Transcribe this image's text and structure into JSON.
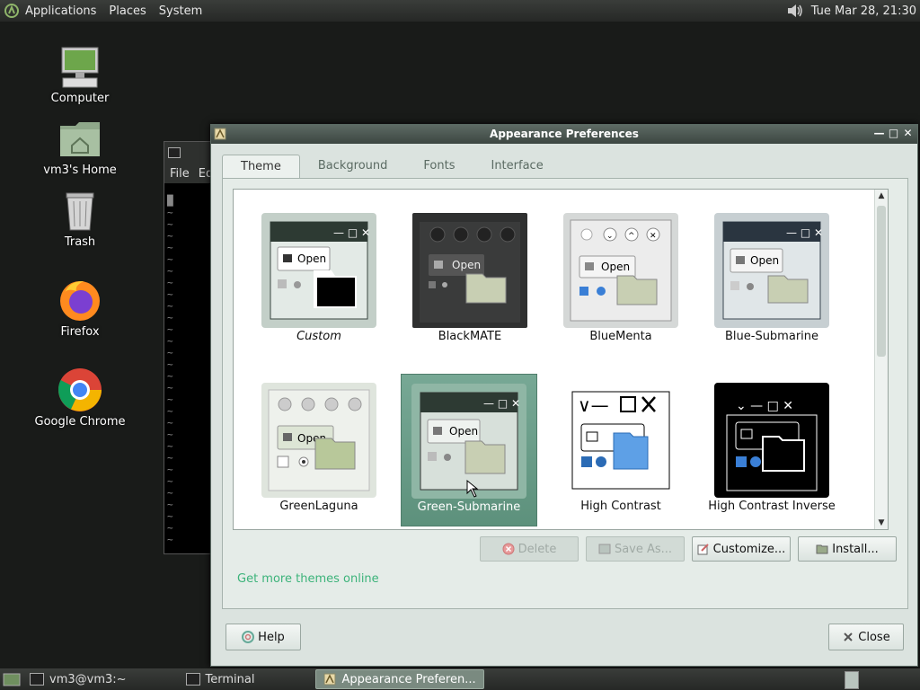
{
  "top_panel": {
    "menus": [
      "Applications",
      "Places",
      "System"
    ],
    "clock": "Tue Mar 28, 21:30"
  },
  "desktop_icons": [
    {
      "label": "Computer",
      "icon": "computer-icon"
    },
    {
      "label": "vm3's Home",
      "icon": "home-folder-icon"
    },
    {
      "label": "Trash",
      "icon": "trash-icon"
    },
    {
      "label": "Firefox",
      "icon": "firefox-icon"
    },
    {
      "label": "Google Chrome",
      "icon": "chrome-icon"
    }
  ],
  "terminal": {
    "menu": [
      "File",
      "Ed"
    ]
  },
  "dialog": {
    "title": "Appearance Preferences",
    "tabs": [
      "Theme",
      "Background",
      "Fonts",
      "Interface"
    ],
    "active_tab": "Theme",
    "themes": [
      {
        "name": "Custom",
        "selected": false
      },
      {
        "name": "BlackMATE",
        "selected": false
      },
      {
        "name": "BlueMenta",
        "selected": false
      },
      {
        "name": "Blue-Submarine",
        "selected": false
      },
      {
        "name": "GreenLaguna",
        "selected": false
      },
      {
        "name": "Green-Submarine",
        "selected": true
      },
      {
        "name": "High Contrast",
        "selected": false
      },
      {
        "name": "High Contrast Inverse",
        "selected": false
      }
    ],
    "thumb_open_label": "Open",
    "buttons": {
      "delete": "Delete",
      "save_as": "Save As...",
      "customize": "Customize...",
      "install": "Install..."
    },
    "more_themes_link": "Get more themes online",
    "help": "Help",
    "close": "Close"
  },
  "taskbar": {
    "tasks": [
      {
        "label": "vm3@vm3:~",
        "active": false
      },
      {
        "label": "Terminal",
        "active": false
      },
      {
        "label": "Appearance Preferen...",
        "active": true
      }
    ]
  },
  "colors": {
    "accent": "#5d917c",
    "link": "#3cb37a",
    "desktop": "#191b19"
  }
}
